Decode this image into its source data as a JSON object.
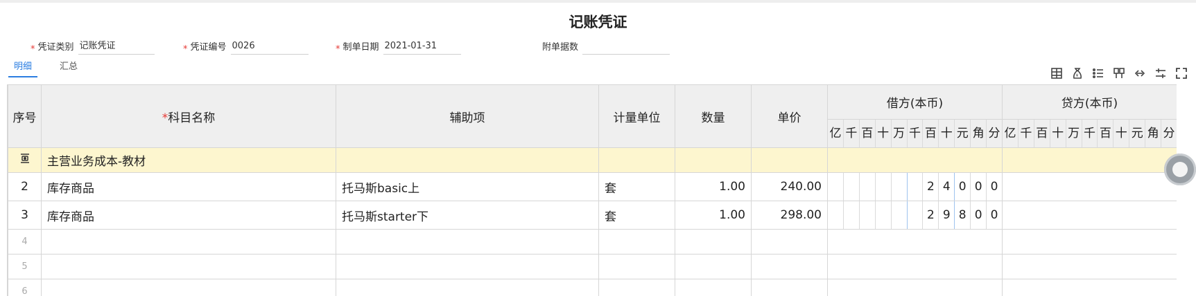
{
  "title": "记账凭证",
  "header": {
    "voucher_type_label": "凭证类别",
    "voucher_type_value": "记账凭证",
    "voucher_no_label": "凭证编号",
    "voucher_no_value": "0026",
    "date_label": "制单日期",
    "date_value": "2021-01-31",
    "attachments_label": "附单据数",
    "attachments_value": ""
  },
  "tabs": [
    {
      "label": "明细",
      "active": true
    },
    {
      "label": "汇总",
      "active": false
    }
  ],
  "toolbar_icons": [
    "table-insert-icon",
    "money-bag-icon",
    "list-settings-icon",
    "columns-icon",
    "link-icon",
    "adjust-icon",
    "fullscreen-icon"
  ],
  "columns": {
    "seq": "序号",
    "account": "科目名称",
    "assist": "辅助项",
    "unit": "计量单位",
    "qty": "数量",
    "price": "单价",
    "debit": "借方(本币)",
    "credit": "贷方(本币)",
    "digit_labels": [
      "亿",
      "千",
      "百",
      "十",
      "万",
      "千",
      "百",
      "十",
      "元",
      "角",
      "分"
    ]
  },
  "rows": [
    {
      "seq": "",
      "account": "主营业务成本-教材",
      "assist": "",
      "unit": "",
      "qty": "",
      "price": "",
      "debit": [
        "",
        "",
        "",
        "",
        "",
        "",
        "",
        "",
        "",
        "",
        ""
      ],
      "credit": [
        "",
        "",
        "",
        "",
        "",
        "",
        "",
        "",
        "",
        "",
        ""
      ]
    },
    {
      "seq": "2",
      "account": "库存商品",
      "assist": "托马斯basic上",
      "unit": "套",
      "qty": "1.00",
      "price": "240.00",
      "debit": [
        "",
        "",
        "",
        "",
        "",
        "",
        "2",
        "4",
        "0",
        "0",
        "0"
      ],
      "credit": [
        "",
        "",
        "",
        "",
        "",
        "",
        "",
        "",
        "",
        "",
        ""
      ]
    },
    {
      "seq": "3",
      "account": "库存商品",
      "assist": "托马斯starter下",
      "unit": "套",
      "qty": "1.00",
      "price": "298.00",
      "debit": [
        "",
        "",
        "",
        "",
        "",
        "",
        "2",
        "9",
        "8",
        "0",
        "0"
      ],
      "credit": [
        "",
        "",
        "",
        "",
        "",
        "",
        "",
        "",
        "",
        "",
        ""
      ]
    },
    {
      "seq": "4",
      "account": "",
      "assist": "",
      "unit": "",
      "qty": "",
      "price": "",
      "debit": [
        "",
        "",
        "",
        "",
        "",
        "",
        "",
        "",
        "",
        "",
        ""
      ],
      "credit": [
        "",
        "",
        "",
        "",
        "",
        "",
        "",
        "",
        "",
        "",
        ""
      ]
    },
    {
      "seq": "5",
      "account": "",
      "assist": "",
      "unit": "",
      "qty": "",
      "price": "",
      "debit": [
        "",
        "",
        "",
        "",
        "",
        "",
        "",
        "",
        "",
        "",
        ""
      ],
      "credit": [
        "",
        "",
        "",
        "",
        "",
        "",
        "",
        "",
        "",
        "",
        ""
      ]
    },
    {
      "seq": "6",
      "account": "",
      "assist": "",
      "unit": "",
      "qty": "",
      "price": "",
      "debit": [
        "",
        "",
        "",
        "",
        "",
        "",
        "",
        "",
        "",
        "",
        ""
      ],
      "credit": [
        "",
        "",
        "",
        "",
        "",
        "",
        "",
        "",
        "",
        "",
        ""
      ]
    }
  ]
}
